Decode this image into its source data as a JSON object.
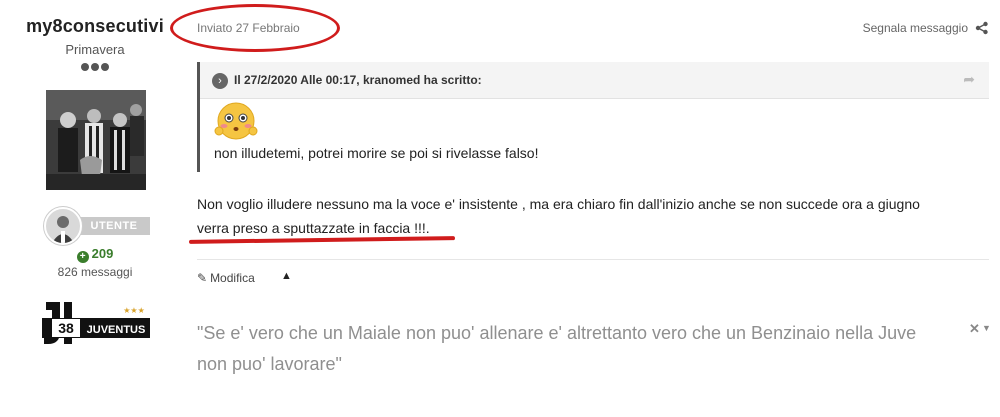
{
  "author": {
    "name": "my8consecutivi",
    "group": "Primavera",
    "badge_label": "UTENTE",
    "reputation": "209",
    "post_count": "826 messaggi"
  },
  "post": {
    "date": "Inviato 27 Febbraio",
    "report_label": "Segnala messaggio",
    "quote": {
      "citation": "Il 27/2/2020 Alle 00:17, kranomed ha scritto:",
      "text": "non illudetemi, potrei morire se poi si rivelasse falso!"
    },
    "body_line1": "Non voglio illudere nessuno ma la voce e' insistente , ma era chiaro fin dall'inizio anche se non succede ora a giugno",
    "body_line2": "verra preso a sputtazzate in faccia !!!.",
    "edit_label": "Modifica",
    "collapse_symbol": "▲"
  },
  "signature": {
    "line1": "\"Se e' vero che un Maiale non puo' allenare e' altrettanto vero che un Benzinaio nella Juve",
    "line2": "non puo' lavorare\"",
    "juve_text": "JUVENTUS",
    "juve_number": "38",
    "juve_stars": "★★★"
  },
  "colors": {
    "annotation_red": "#d01c1c",
    "reputation_green": "#3a7d2c",
    "quote_bar": "#555555",
    "signature_gray": "#8f8f8f"
  }
}
